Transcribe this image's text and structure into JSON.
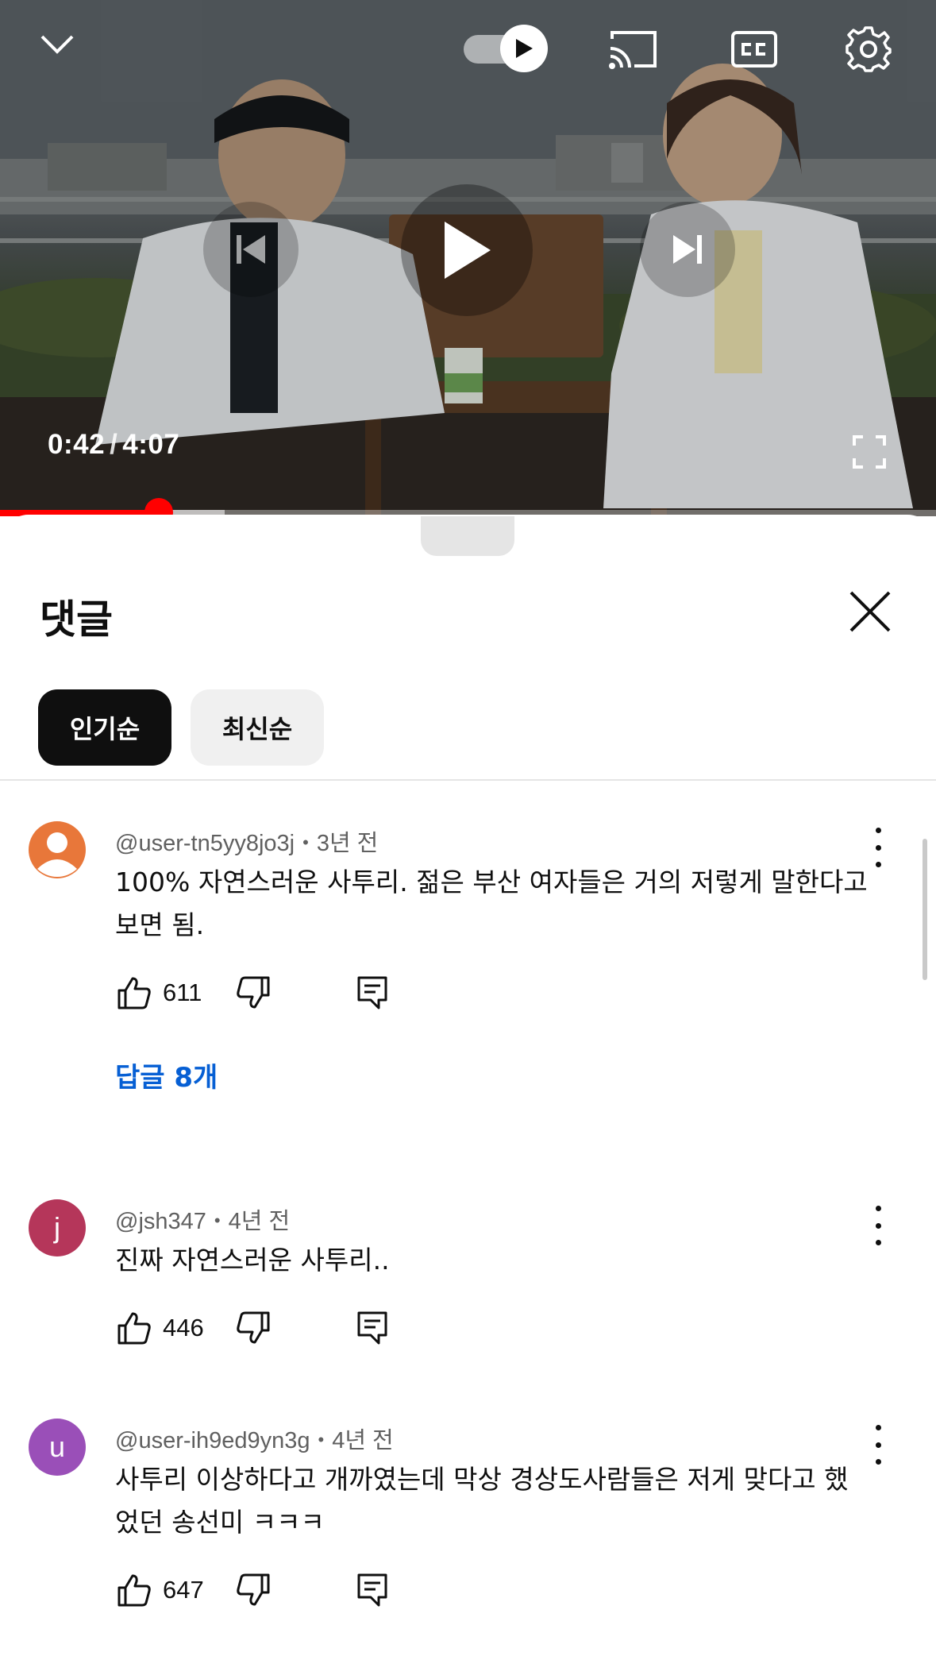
{
  "player": {
    "current_time": "0:42",
    "separator": "/",
    "duration": "4:07",
    "progress_fraction": 0.17,
    "buffer_fraction": 0.24,
    "autoplay_on": true,
    "accent_color": "#ff0000",
    "icons": {
      "collapse": "chevron-down-icon",
      "autoplay": "autoplay-toggle",
      "cast": "cast-icon",
      "captions": "closed-captions-icon",
      "settings": "gear-icon",
      "previous": "skip-previous-icon",
      "play": "play-icon",
      "next": "skip-next-icon",
      "fullscreen": "fullscreen-icon"
    }
  },
  "comments_panel": {
    "title": "댓글",
    "close_icon": "close-icon",
    "sort_chips": [
      {
        "label": "인기순",
        "selected": true
      },
      {
        "label": "최신순",
        "selected": false
      }
    ],
    "comments": [
      {
        "avatar_letter": "",
        "avatar_color": "#e8773a",
        "author": "@user-tn5yy8jo3j",
        "time": "3년 전",
        "text": "100% 자연스러운 사투리. 젊은 부산 여자들은 거의 저렇게 말한다고 보면 됨.",
        "likes": "611",
        "replies_label": "답글 8개"
      },
      {
        "avatar_letter": "j",
        "avatar_color": "#b5365a",
        "author": "@jsh347",
        "time": "4년 전",
        "text": "진짜 자연스러운 사투리..",
        "likes": "446"
      },
      {
        "avatar_letter": "u",
        "avatar_color": "#9a4fb8",
        "author": "@user-ih9ed9yn3g",
        "time": "4년 전",
        "text": "사투리 이상하다고 개까였는데 막상 경상도사람들은 저게 맞다고 했었던 송선미 ㅋㅋㅋ",
        "likes": "647"
      }
    ]
  }
}
